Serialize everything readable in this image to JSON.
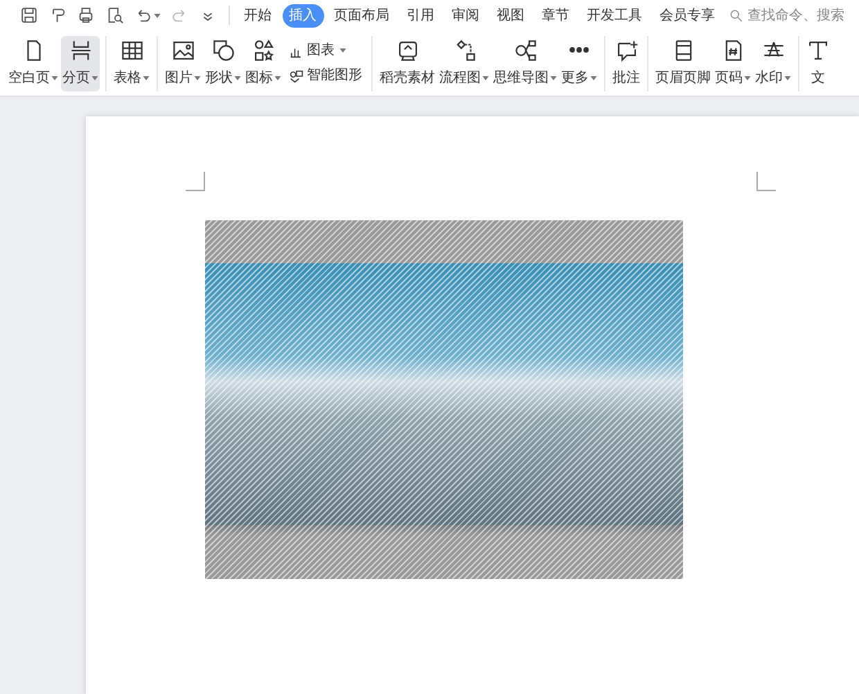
{
  "quick_access": [
    {
      "kind": "save"
    },
    {
      "kind": "format"
    },
    {
      "kind": "print"
    },
    {
      "kind": "preview"
    },
    {
      "kind": "undo",
      "caret": true
    },
    {
      "kind": "redo",
      "disabled": true
    },
    {
      "kind": "customize"
    }
  ],
  "tabs": [
    {
      "label": "开始",
      "selected": false
    },
    {
      "label": "插入",
      "selected": true
    },
    {
      "label": "页面布局",
      "selected": false
    },
    {
      "label": "引用",
      "selected": false
    },
    {
      "label": "审阅",
      "selected": false
    },
    {
      "label": "视图",
      "selected": false
    },
    {
      "label": "章节",
      "selected": false
    },
    {
      "label": "开发工具",
      "selected": false
    },
    {
      "label": "会员专享",
      "selected": false
    }
  ],
  "search": {
    "placeholder": "查找命令、搜索"
  },
  "ribbon_groups": [
    {
      "items": [
        {
          "kind": "large",
          "label": "空白页",
          "caret": true,
          "selected": false
        },
        {
          "kind": "large",
          "label": "分页",
          "caret": true,
          "selected": true
        }
      ]
    },
    {
      "items": [
        {
          "kind": "large",
          "label": "表格",
          "caret": true,
          "selected": false
        }
      ]
    },
    {
      "items": [
        {
          "kind": "large",
          "label": "图片",
          "caret": true,
          "selected": false
        },
        {
          "kind": "large",
          "label": "形状",
          "caret": true,
          "selected": false
        },
        {
          "kind": "large",
          "label": "图标",
          "caret": true,
          "selected": false
        },
        {
          "kind": "stack",
          "entries": [
            {
              "label": "图表",
              "caret": true
            },
            {
              "label": "智能图形",
              "caret": false
            }
          ]
        }
      ]
    },
    {
      "items": [
        {
          "kind": "large",
          "label": "稻壳素材",
          "caret": false,
          "selected": false
        },
        {
          "kind": "large",
          "label": "流程图",
          "caret": true,
          "selected": false
        },
        {
          "kind": "large",
          "label": "思维导图",
          "caret": true,
          "selected": false
        },
        {
          "kind": "large",
          "label": "更多",
          "caret": true,
          "selected": false
        }
      ]
    },
    {
      "items": [
        {
          "kind": "large",
          "label": "批注",
          "caret": false,
          "selected": false
        }
      ]
    },
    {
      "items": [
        {
          "kind": "large",
          "label": "页眉页脚",
          "caret": false,
          "selected": false
        },
        {
          "kind": "large",
          "label": "页码",
          "caret": true,
          "selected": false
        },
        {
          "kind": "large",
          "label": "水印",
          "caret": true,
          "selected": false
        }
      ]
    },
    {
      "items": [
        {
          "kind": "large",
          "label": "文",
          "caret": false,
          "selected": false
        }
      ]
    }
  ],
  "document": {
    "image": {
      "kind": "photo"
    }
  }
}
